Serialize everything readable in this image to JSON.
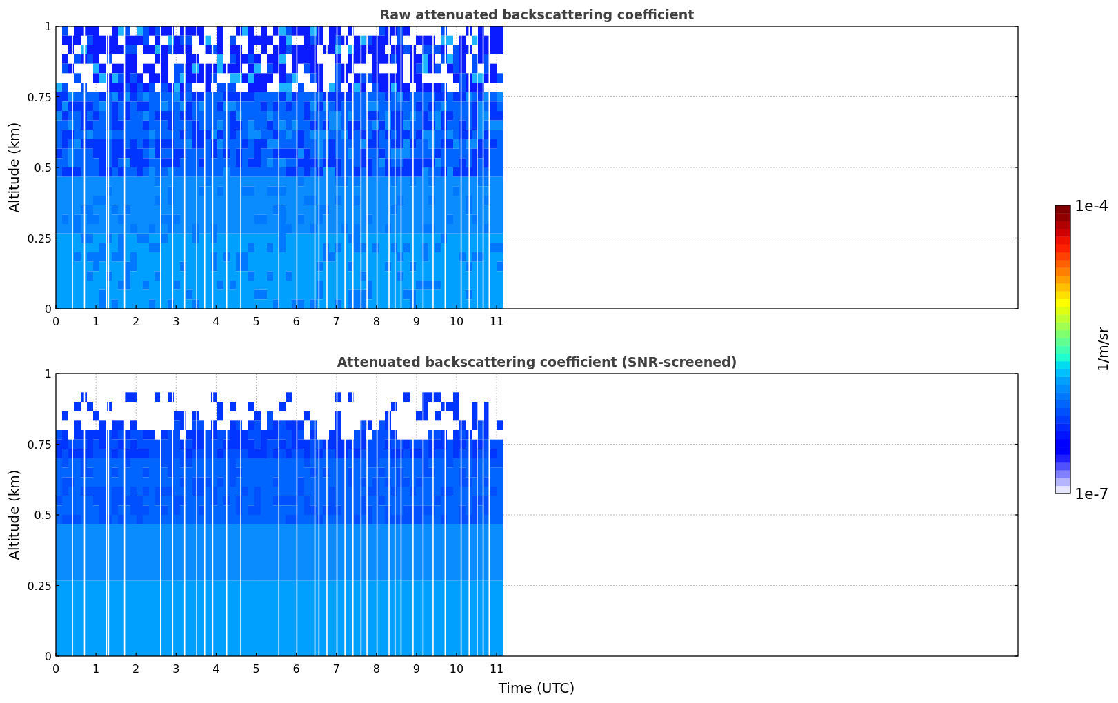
{
  "panels": [
    {
      "kind": "raw",
      "title": "Raw attenuated backscattering coefficient",
      "ylabel": "Altitude (km)",
      "yticks": [
        "1",
        "0.75",
        "0.5",
        "0.25",
        "0"
      ],
      "xticks": [
        "0",
        "1",
        "2",
        "3",
        "4",
        "5",
        "6",
        "7",
        "8",
        "9",
        "10",
        "11"
      ]
    },
    {
      "kind": "screened",
      "title": "Attenuated backscattering coefficient (SNR-screened)",
      "ylabel": "Altitude (km)",
      "yticks": [
        "1",
        "0.75",
        "0.5",
        "0.25",
        "0"
      ],
      "xticks": [
        "0",
        "1",
        "2",
        "3",
        "4",
        "5",
        "6",
        "7",
        "8",
        "9",
        "10",
        "11"
      ]
    }
  ],
  "xlabel": "Time (UTC)",
  "colorbar": {
    "label": "1/m/sr",
    "max_label": "1e-4",
    "min_label": "1e-7"
  }
}
